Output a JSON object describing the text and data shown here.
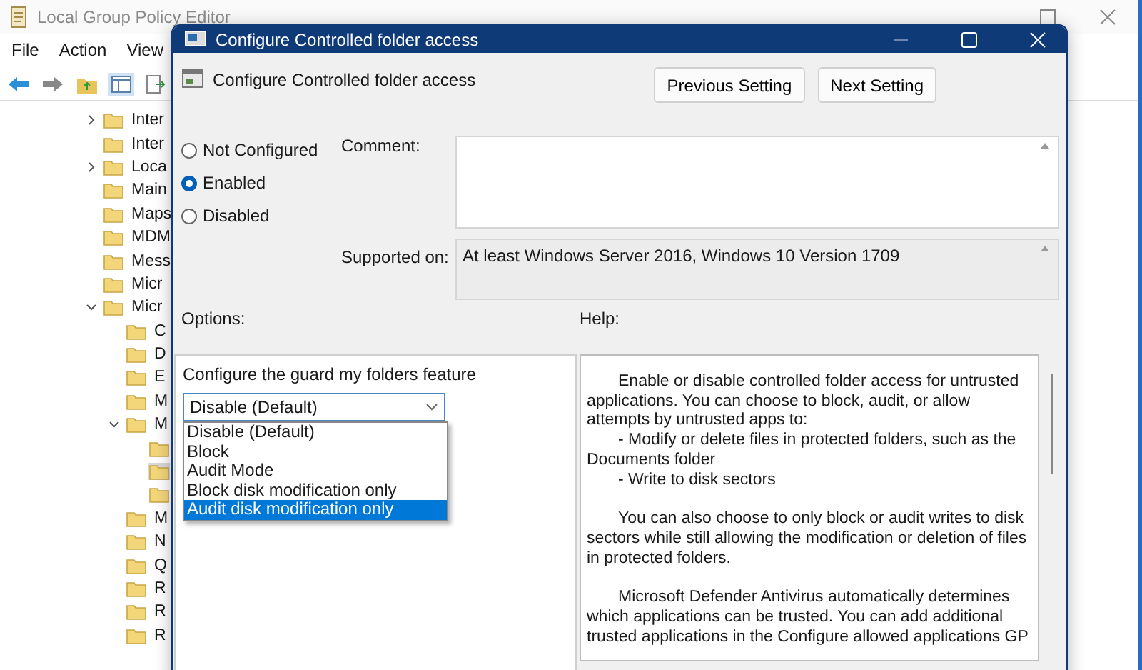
{
  "background_window": {
    "title": "Local Group Policy Editor",
    "menu": [
      "File",
      "Action",
      "View"
    ],
    "tree": [
      {
        "label": "Inter",
        "kind": "collapsed",
        "selected": false
      },
      {
        "label": "Inter",
        "kind": "leaf",
        "selected": false
      },
      {
        "label": "Loca",
        "kind": "collapsed",
        "selected": false
      },
      {
        "label": "Main",
        "kind": "leaf",
        "selected": false
      },
      {
        "label": "Maps",
        "kind": "leaf",
        "selected": false
      },
      {
        "label": "MDM",
        "kind": "leaf",
        "selected": false
      },
      {
        "label": "Mess",
        "kind": "leaf",
        "selected": false
      },
      {
        "label": "Micr",
        "kind": "leaf",
        "selected": false
      },
      {
        "label": "Micr",
        "kind": "expanded",
        "selected": false,
        "children": [
          {
            "label": "C",
            "kind": "leaf",
            "selected": false
          },
          {
            "label": "D",
            "kind": "leaf",
            "selected": false
          },
          {
            "label": "E",
            "kind": "leaf",
            "selected": false
          },
          {
            "label": "M",
            "kind": "leaf",
            "selected": false
          },
          {
            "label": "M",
            "kind": "expanded",
            "selected": false,
            "children": [
              {
                "selected": false
              },
              {
                "selected": true
              },
              {
                "selected": false
              }
            ]
          },
          {
            "label": "M",
            "kind": "leaf",
            "selected": false
          },
          {
            "label": "N",
            "kind": "leaf",
            "selected": false
          },
          {
            "label": "Q",
            "kind": "leaf",
            "selected": false
          },
          {
            "label": "R",
            "kind": "leaf",
            "selected": false
          },
          {
            "label": "R",
            "kind": "leaf",
            "selected": false
          },
          {
            "label": "R",
            "kind": "leaf",
            "selected": false
          }
        ]
      }
    ]
  },
  "dialog": {
    "title": "Configure Controlled folder access",
    "heading": "Configure Controlled folder access",
    "nav_buttons": [
      "Previous Setting",
      "Next Setting"
    ],
    "states": [
      {
        "label": "Not Configured",
        "selected": false
      },
      {
        "label": "Enabled",
        "selected": true
      },
      {
        "label": "Disabled",
        "selected": false
      }
    ],
    "comment_label": "Comment:",
    "supported_label": "Supported on:",
    "supported_value": "At least Windows Server 2016, Windows 10 Version 1709",
    "options_label": "Options:",
    "help_label": "Help:",
    "option_caption": "Configure the guard my folders feature",
    "dropdown_value": "Disable (Default)",
    "dropdown_items": [
      {
        "label": "Disable (Default)",
        "selected": false
      },
      {
        "label": "Block",
        "selected": false
      },
      {
        "label": "Audit Mode",
        "selected": false
      },
      {
        "label": "Block disk modification only",
        "selected": false
      },
      {
        "label": "Audit disk modification only",
        "selected": true
      }
    ],
    "help": [
      {
        "kind": "para",
        "text": "Enable or disable controlled folder access for untrusted applications. You can choose to block, audit, or allow attempts by untrusted apps to:"
      },
      {
        "kind": "bullet",
        "text": "- Modify or delete files in protected folders, such as the Documents folder"
      },
      {
        "kind": "bullet",
        "text": "- Write to disk sectors"
      },
      {
        "kind": "para",
        "text": "You can also choose to only block or audit writes to disk sectors while still allowing the modification or deletion of files in protected folders."
      },
      {
        "kind": "para",
        "text": "Microsoft Defender Antivirus automatically determines which applications can be trusted. You can add additional trusted applications in the Configure allowed applications GP"
      }
    ]
  }
}
